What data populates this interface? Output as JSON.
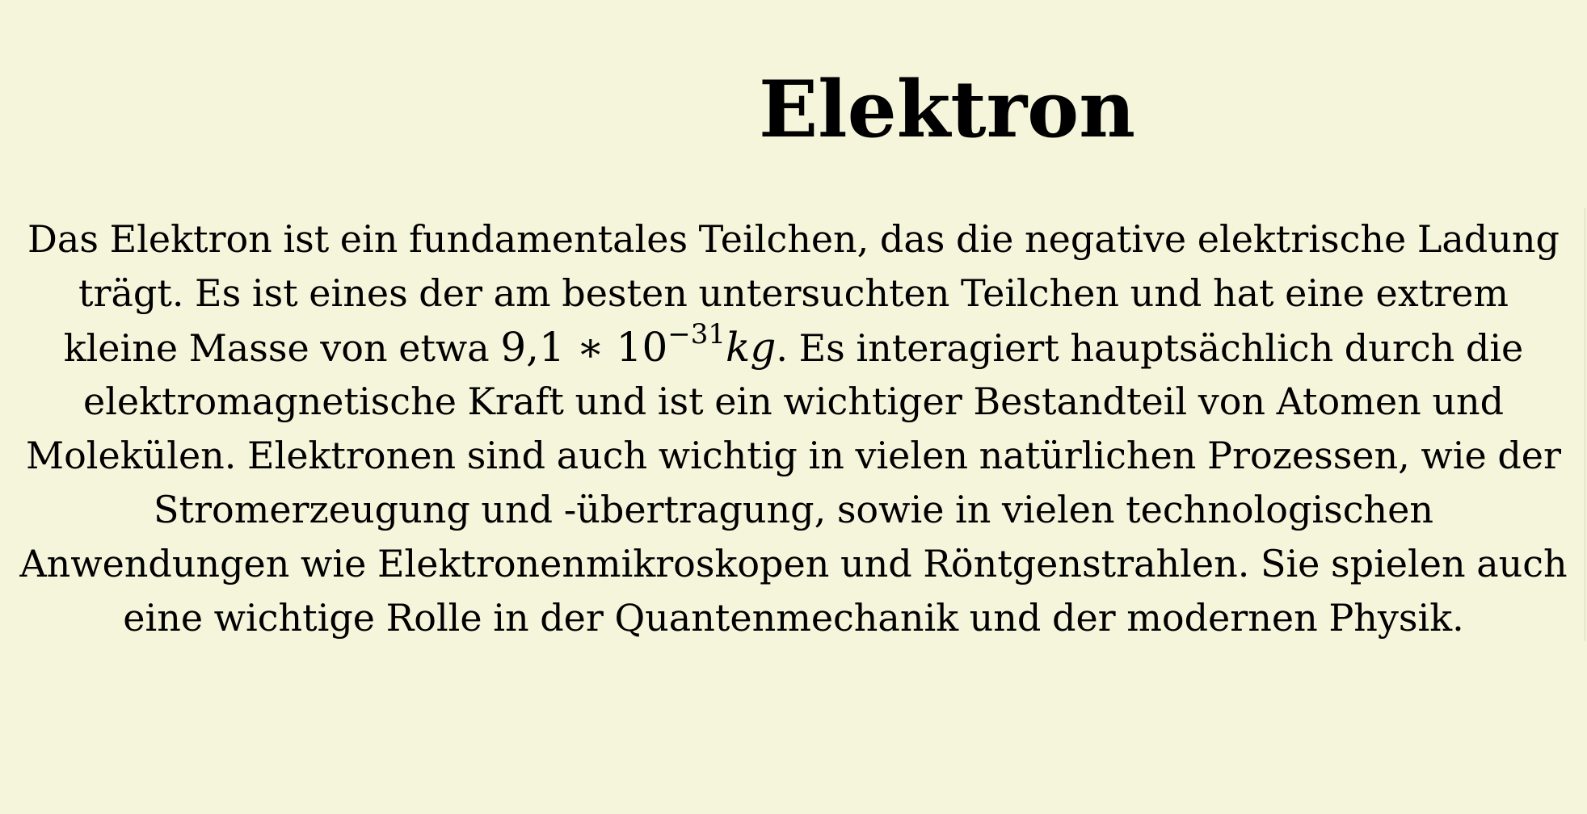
{
  "article": {
    "title": "Elektron",
    "paragraph": {
      "before_math": "Das Elektron ist ein fundamentales Teilchen, das die negative elektrische Ladung trägt. Es ist eines der am besten untersuchten Teilchen und hat eine extrem kleine Masse von etwa ",
      "math": {
        "mantissa": "9,1 ∗ 10",
        "exponent": "−31",
        "unit": "kg"
      },
      "after_math": ". Es interagiert hauptsächlich durch die elektromagnetische Kraft und ist ein wichtiger Bestandteil von Atomen und Molekülen. Elektronen sind auch wichtig in vielen natürlichen Prozessen, wie der Stromerzeugung und -übertragung, sowie in vielen technologischen Anwendungen wie Elektronenmikroskopen und Röntgenstrahlen. Sie spielen auch eine wichtige Rolle in der Quantenmechanik und der modernen Physik."
    }
  },
  "colors": {
    "background": "#f5f5dc",
    "text": "#000000"
  }
}
